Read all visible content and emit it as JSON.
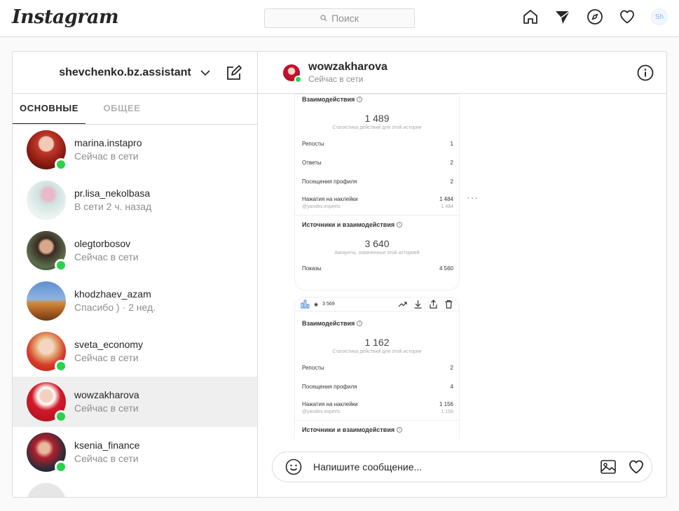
{
  "topbar": {
    "logo": "Instagram",
    "search_placeholder": "Поиск",
    "profile_initials": "Sh"
  },
  "sidebar": {
    "account": "shevchenko.bz.assistant",
    "tabs": [
      {
        "label": "ОСНОВНЫЕ",
        "active": true
      },
      {
        "label": "ОБЩЕЕ",
        "active": false
      }
    ],
    "threads": [
      {
        "name": "marina.instapro",
        "status": "Сейчас в сети",
        "online": true
      },
      {
        "name": "pr.lisa_nekolbasa",
        "status": "В сети 2 ч. назад",
        "online": false
      },
      {
        "name": "olegtorbosov",
        "status": "Сейчас в сети",
        "online": true
      },
      {
        "name": "khodzhaev_azam",
        "status": "Спасибо ) · 2 нед.",
        "online": false
      },
      {
        "name": "sveta_economy",
        "status": "Сейчас в сети",
        "online": true
      },
      {
        "name": "wowzakharova",
        "status": "Сейчас в сети",
        "online": true,
        "selected": true
      },
      {
        "name": "ksenia_finance",
        "status": "Сейчас в сети",
        "online": true
      }
    ]
  },
  "conversation": {
    "name": "wowzakharova",
    "status": "Сейчас в сети",
    "card1": {
      "section1": "Взаимодействия",
      "total1": "1 489",
      "total1_caption": "Статистика действий для этой истории",
      "rows": [
        {
          "label": "Репосты",
          "value": "1"
        },
        {
          "label": "Ответы",
          "value": "2"
        },
        {
          "label": "Посещения профиля",
          "value": "2"
        },
        {
          "label": "Нажатия на наклейки",
          "value": "1 484"
        }
      ],
      "sticker_sub": {
        "label": "@yandex.experts",
        "value": "1 484"
      },
      "section2": "Источники и взаимодействия",
      "total2": "3 640",
      "total2_caption": "Аккаунты, охваченные этой историей",
      "shows": {
        "label": "Показы",
        "value": "4 560"
      }
    },
    "card2": {
      "views": "3 569",
      "section1": "Взаимодействия",
      "total1": "1 162",
      "total1_caption": "Статистика действий для этой истории",
      "rows": [
        {
          "label": "Репосты",
          "value": "2"
        },
        {
          "label": "Посещения профиля",
          "value": "4"
        },
        {
          "label": "Нажатия на наклейки",
          "value": "1 156"
        }
      ],
      "sticker_sub": {
        "label": "@yandex.experts",
        "value": "1 156"
      },
      "section2": "Источники и взаимодействия"
    },
    "more": "···",
    "composer_placeholder": "Напишите сообщение..."
  }
}
